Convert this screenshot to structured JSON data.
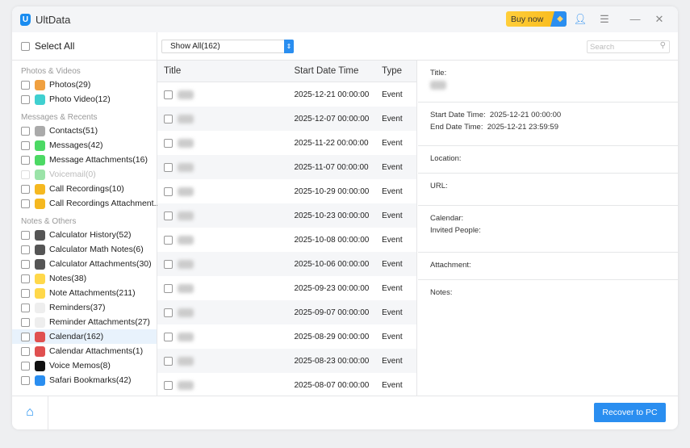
{
  "app": {
    "title": "UltData",
    "logo_letter": "U",
    "buy_now": "Buy now"
  },
  "sidebar": {
    "select_all": "Select All",
    "groups": [
      {
        "label": "Photos & Videos",
        "items": [
          {
            "label": "Photos(29)",
            "color": "#f0a040"
          },
          {
            "label": "Photo Video(12)",
            "color": "#40d0d0"
          }
        ]
      },
      {
        "label": "Messages & Recents",
        "items": [
          {
            "label": "Contacts(51)",
            "color": "#aaaaaa"
          },
          {
            "label": "Messages(42)",
            "color": "#4cd964"
          },
          {
            "label": "Message Attachments(16)",
            "color": "#4cd964"
          },
          {
            "label": "Voicemail(0)",
            "color": "#9be3a8",
            "disabled": true
          },
          {
            "label": "Call Recordings(10)",
            "color": "#f5b820"
          },
          {
            "label": "Call Recordings Attachment...",
            "color": "#f5b820"
          }
        ]
      },
      {
        "label": "Notes & Others",
        "items": [
          {
            "label": "Calculator History(52)",
            "color": "#555555"
          },
          {
            "label": "Calculator Math Notes(6)",
            "color": "#555555"
          },
          {
            "label": "Calculator Attachments(30)",
            "color": "#555555"
          },
          {
            "label": "Notes(38)",
            "color": "#ffd84a"
          },
          {
            "label": "Note Attachments(211)",
            "color": "#ffd84a"
          },
          {
            "label": "Reminders(37)",
            "color": "#eeeeee"
          },
          {
            "label": "Reminder Attachments(27)",
            "color": "#eeeeee"
          },
          {
            "label": "Calendar(162)",
            "color": "#e05050",
            "selected": true
          },
          {
            "label": "Calendar Attachments(1)",
            "color": "#e05050"
          },
          {
            "label": "Voice Memos(8)",
            "color": "#111111"
          },
          {
            "label": "Safari Bookmarks(42)",
            "color": "#2a8ef0"
          }
        ]
      }
    ]
  },
  "toolbar": {
    "filter": "Show All(162)",
    "search_placeholder": "Search"
  },
  "table": {
    "headers": [
      "Title",
      "Start Date Time",
      "Type"
    ],
    "rows": [
      {
        "date": "2025-12-21 00:00:00",
        "type": "Event"
      },
      {
        "date": "2025-12-07 00:00:00",
        "type": "Event"
      },
      {
        "date": "2025-11-22 00:00:00",
        "type": "Event"
      },
      {
        "date": "2025-11-07 00:00:00",
        "type": "Event"
      },
      {
        "date": "2025-10-29 00:00:00",
        "type": "Event"
      },
      {
        "date": "2025-10-23 00:00:00",
        "type": "Event"
      },
      {
        "date": "2025-10-08 00:00:00",
        "type": "Event"
      },
      {
        "date": "2025-10-06 00:00:00",
        "type": "Event"
      },
      {
        "date": "2025-09-23 00:00:00",
        "type": "Event"
      },
      {
        "date": "2025-09-07 00:00:00",
        "type": "Event"
      },
      {
        "date": "2025-08-29 00:00:00",
        "type": "Event"
      },
      {
        "date": "2025-08-23 00:00:00",
        "type": "Event"
      },
      {
        "date": "2025-08-07 00:00:00",
        "type": "Event"
      }
    ]
  },
  "detail": {
    "title_label": "Title:",
    "start_label": "Start Date Time:",
    "start_value": "2025-12-21 00:00:00",
    "end_label": "End Date Time:",
    "end_value": "2025-12-21 23:59:59",
    "location_label": "Location:",
    "url_label": "URL:",
    "calendar_label": "Calendar:",
    "invited_label": "Invited People:",
    "attachment_label": "Attachment:",
    "notes_label": "Notes:"
  },
  "footer": {
    "recover": "Recover to PC"
  }
}
